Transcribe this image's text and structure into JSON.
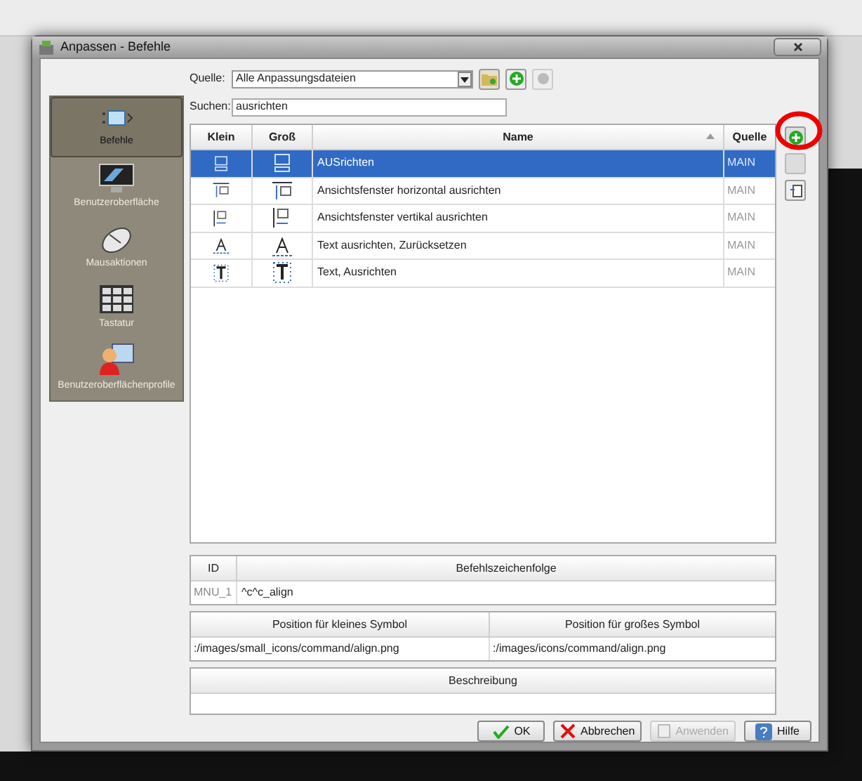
{
  "window": {
    "title": "Anpassen - Befehle"
  },
  "source": {
    "label": "Quelle:",
    "value": "Alle Anpassungsdateien"
  },
  "search": {
    "label": "Suchen:",
    "value": "ausrichten"
  },
  "categories": [
    {
      "label": "Befehle",
      "kind": "command",
      "selected": true
    },
    {
      "label": "Benutzeroberfläche",
      "kind": "monitor",
      "selected": false
    },
    {
      "label": "Mausaktionen",
      "kind": "mouse",
      "selected": false
    },
    {
      "label": "Tastatur",
      "kind": "keyboard",
      "selected": false
    },
    {
      "label": "Benutzeroberflächenprofile",
      "kind": "profile",
      "selected": false
    }
  ],
  "table": {
    "columns": [
      "Klein",
      "Groß",
      "Name",
      "Quelle"
    ],
    "rows": [
      {
        "kind": "align",
        "name": "AUSrichten",
        "source": "MAIN",
        "selected": true
      },
      {
        "kind": "hview",
        "name": "Ansichtsfenster horizontal ausrichten",
        "source": "MAIN",
        "selected": false
      },
      {
        "kind": "vview",
        "name": "Ansichtsfenster vertikal ausrichten",
        "source": "MAIN",
        "selected": false
      },
      {
        "kind": "texta",
        "name": "Text ausrichten, Zurücksetzen",
        "source": "MAIN",
        "selected": false
      },
      {
        "kind": "textt",
        "name": "Text, Ausrichten",
        "source": "MAIN",
        "selected": false
      }
    ]
  },
  "details": {
    "id_header": "ID",
    "sequence_header": "Befehlszeichenfolge",
    "id": "MNU_1",
    "sequence": "^c^c_align"
  },
  "icons": {
    "small_header": "Position für kleines Symbol",
    "large_header": "Position für großes Symbol",
    "small": ":/images/small_icons/command/align.png",
    "large": ":/images/icons/command/align.png"
  },
  "description": {
    "header": "Beschreibung"
  },
  "buttons": [
    {
      "label": "OK",
      "kind": "ok",
      "disabled": false
    },
    {
      "label": "Abbrechen",
      "kind": "cancel",
      "disabled": false
    },
    {
      "label": "Anwenden",
      "kind": "apply",
      "disabled": true
    },
    {
      "label": "Hilfe",
      "kind": "help",
      "disabled": false
    }
  ]
}
